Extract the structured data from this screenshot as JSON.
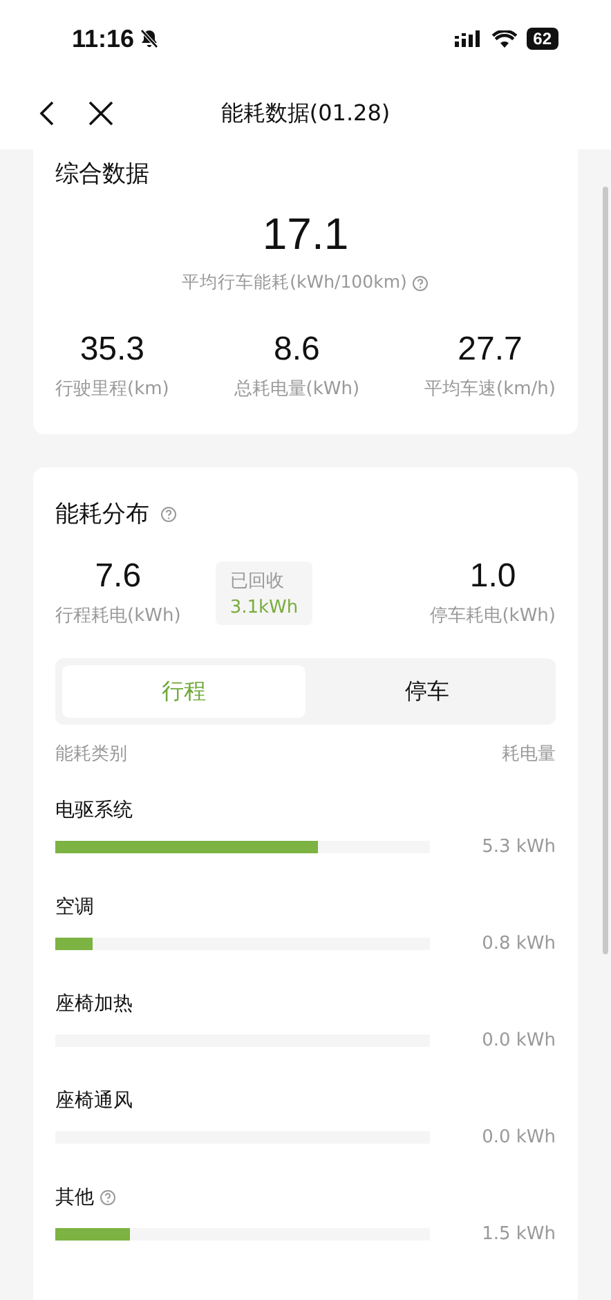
{
  "status_bar": {
    "time": "11:16",
    "battery": "62"
  },
  "nav": {
    "title": "能耗数据(01.28)"
  },
  "summary": {
    "title": "综合数据",
    "main_value": "17.1",
    "main_label": "平均行车能耗(kWh/100km)",
    "stats": [
      {
        "value": "35.3",
        "label": "行驶里程(km)"
      },
      {
        "value": "8.6",
        "label": "总耗电量(kWh)"
      },
      {
        "value": "27.7",
        "label": "平均车速(km/h)"
      }
    ]
  },
  "distribution": {
    "title": "能耗分布",
    "trip_value": "7.6",
    "trip_label": "行程耗电(kWh)",
    "recovered_label": "已回收",
    "recovered_value": "3.1kWh",
    "parking_value": "1.0",
    "parking_label": "停车耗电(kWh)",
    "tabs": [
      {
        "label": "行程",
        "selected": true
      },
      {
        "label": "停车",
        "selected": false
      }
    ],
    "columns": [
      "能耗类别",
      "耗电量"
    ],
    "rows": [
      {
        "name": "电驱系统",
        "level": 0.7,
        "reading": "5.3 kWh",
        "help": false
      },
      {
        "name": "空调",
        "level": 0.1,
        "reading": "0.8 kWh",
        "help": false
      },
      {
        "name": "座椅加热",
        "level": 0,
        "reading": "0.0 kWh",
        "help": false
      },
      {
        "name": "座椅通风",
        "level": 0,
        "reading": "0.0 kWh",
        "help": false
      },
      {
        "name": "其他",
        "level": 0.2,
        "reading": "1.5 kWh",
        "help": true
      }
    ]
  }
}
